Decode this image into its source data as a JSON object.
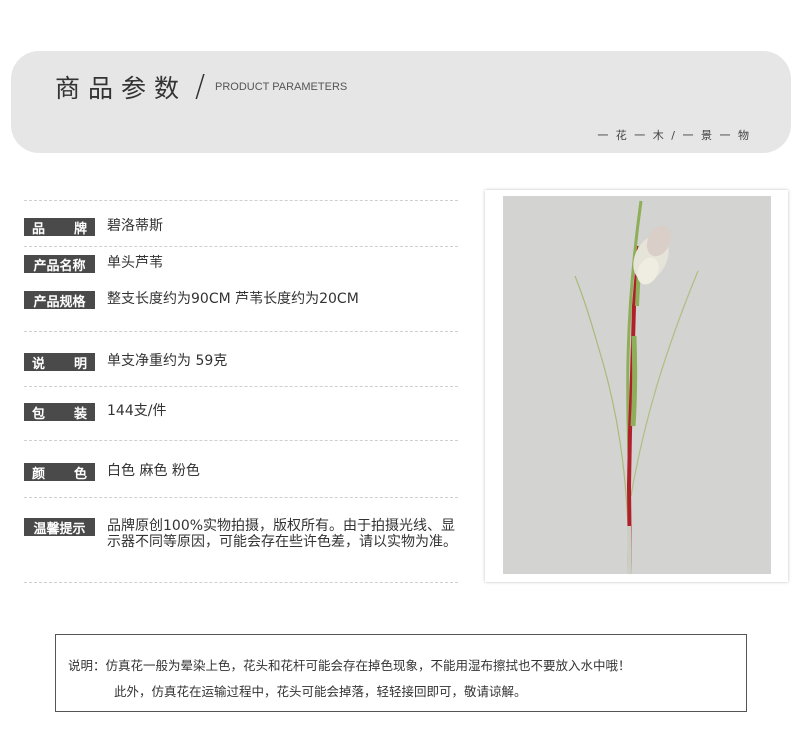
{
  "header": {
    "title_cn": "商品参数",
    "slash": "/",
    "title_en": "PRODUCT PARAMETERS",
    "motto": "一 花 一 木 / 一 景 一 物"
  },
  "params": [
    {
      "label_a": "品",
      "label_b": "牌",
      "value": "碧洛蒂斯"
    },
    {
      "label": "产品名称",
      "value": "单头芦苇"
    },
    {
      "label": "产品规格",
      "value": "整支长度约为90CM  芦苇长度约为20CM"
    },
    {
      "label_a": "说",
      "label_b": "明",
      "value": "单支净重约为 59克"
    },
    {
      "label_a": "包",
      "label_b": "装",
      "value": "144支/件"
    },
    {
      "label_a": "颜",
      "label_b": "色",
      "value": "白色 麻色 粉色"
    },
    {
      "label": "温馨提示",
      "value": "品牌原创100%实物拍摄，版权所有。由于拍摄光线、显示器不同等原因，可能会存在些许色差，请以实物为准。"
    }
  ],
  "note": {
    "line1": "说明：仿真花一般为晕染上色，花头和花杆可能会存在掉色现象，不能用湿布擦拭也不要放入水中哦！",
    "line2": "此外，仿真花在运输过程中，花头可能会掉落，轻轻接回即可，敬请谅解。"
  },
  "colors": {
    "banner_bg": "#e6e6e6",
    "label_bg": "#4a4a4a",
    "photo_bg": "#d3d3d1",
    "stem_red": "#b0202a",
    "leaf_green": "#8fae5a"
  }
}
